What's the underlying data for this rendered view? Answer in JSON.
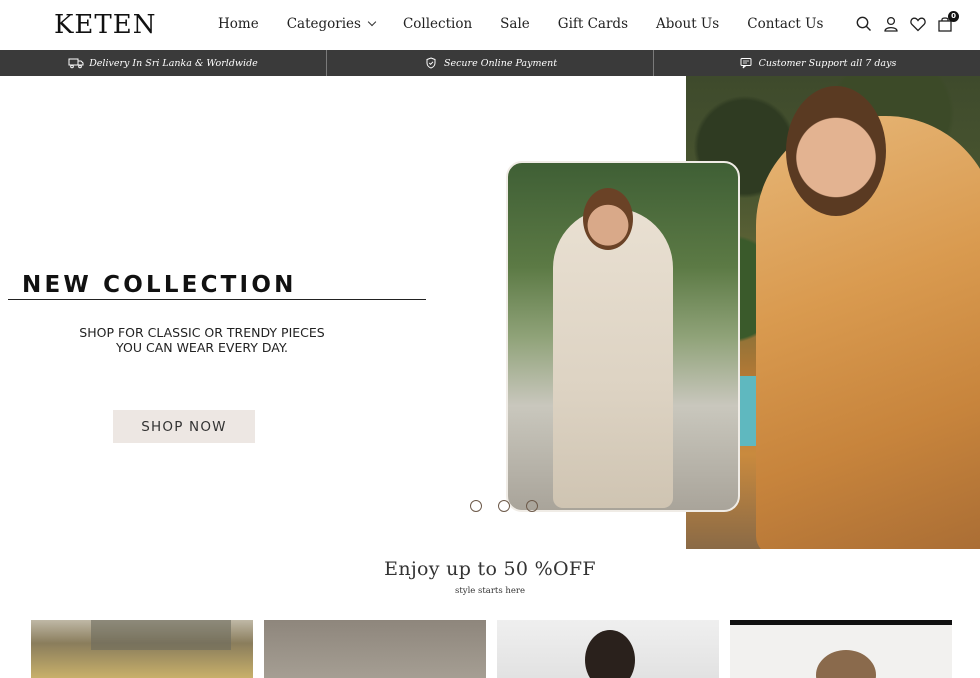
{
  "brand": {
    "logo_text": "KETEN"
  },
  "nav": {
    "items": [
      {
        "label": "Home"
      },
      {
        "label": "Categories"
      },
      {
        "label": "Collection"
      },
      {
        "label": "Sale"
      },
      {
        "label": "Gift Cards"
      },
      {
        "label": "About Us"
      },
      {
        "label": "Contact Us"
      }
    ]
  },
  "header_icons": {
    "search": "search-icon",
    "account": "user-icon",
    "wishlist": "heart-icon",
    "cart": "bag-icon",
    "cart_count": "0"
  },
  "infobar": {
    "items": [
      {
        "icon": "truck-icon",
        "label": "Delivery In Sri Lanka & Worldwide"
      },
      {
        "icon": "shield-icon",
        "label": "Secure Online Payment"
      },
      {
        "icon": "chat-icon",
        "label": "Customer Support all 7 days"
      }
    ]
  },
  "hero": {
    "title": "NEW COLLECTION",
    "subtitle_line1": "SHOP FOR CLASSIC OR TRENDY PIECES",
    "subtitle_line2": "YOU CAN WEAR EVERY DAY.",
    "cta_label": "SHOP NOW",
    "slides_count": 3
  },
  "offer": {
    "title": "Enjoy up to 50 %OFF",
    "subtitle": "style starts here"
  },
  "colors": {
    "infobar_bg": "#3a3a3a",
    "cta_bg": "#ede7e3",
    "text": "#222222"
  }
}
